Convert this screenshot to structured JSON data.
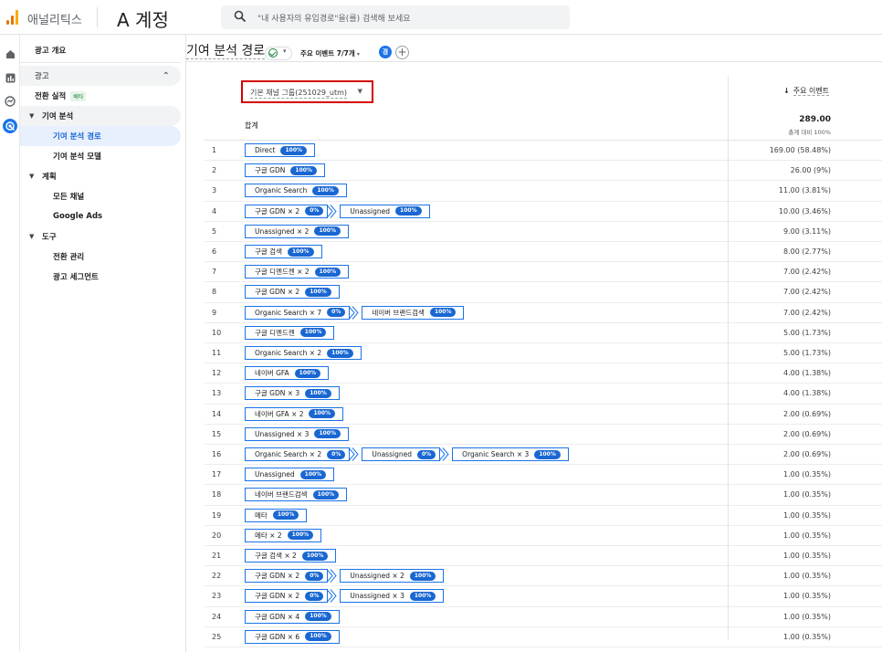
{
  "app": {
    "product_name": "애널리틱스",
    "account_name": "A 계정"
  },
  "search": {
    "placeholder": "\"내 사용자의 유입경로\"을(를) 검색해 보세요"
  },
  "rail": {
    "icons": [
      "home-icon",
      "reports-icon",
      "explore-icon",
      "advertising-icon"
    ]
  },
  "sidebar": {
    "overview": "광고 개요",
    "ads_group": "광고",
    "conversion_perf": "전환 실적",
    "beta": "베타",
    "attribution": "기여 분석",
    "attribution_paths": "기여 분석 경로",
    "attribution_models": "기여 분석 모델",
    "planning": "계획",
    "all_channels": "모든 채널",
    "google_ads": "Google Ads",
    "tools": "도구",
    "conversion_mgmt": "전환 관리",
    "ad_segments": "광고 세그먼트"
  },
  "header": {
    "page_title": "기여 분석 경로",
    "key_events_filter": "주요 이벤트 7/7개",
    "avatar_letter": "경"
  },
  "table": {
    "dimension_label": "기본 채널 그룹(251029_utm)",
    "metric_label": "주요 이벤트",
    "total_label": "합계",
    "total_value": "289.00",
    "total_sub": "총계 대비 100%",
    "rows": [
      {
        "n": "1",
        "steps": [
          {
            "label": "Direct",
            "pct": "100%"
          }
        ],
        "value": "169.00 (58.48%)"
      },
      {
        "n": "2",
        "steps": [
          {
            "label": "구글 GDN",
            "pct": "100%"
          }
        ],
        "value": "26.00 (9%)"
      },
      {
        "n": "3",
        "steps": [
          {
            "label": "Organic Search",
            "pct": "100%"
          }
        ],
        "value": "11.00 (3.81%)"
      },
      {
        "n": "4",
        "steps": [
          {
            "label": "구글 GDN × 2",
            "pct": "0%"
          },
          {
            "label": "Unassigned",
            "pct": "100%"
          }
        ],
        "value": "10.00 (3.46%)"
      },
      {
        "n": "5",
        "steps": [
          {
            "label": "Unassigned × 2",
            "pct": "100%"
          }
        ],
        "value": "9.00 (3.11%)"
      },
      {
        "n": "6",
        "steps": [
          {
            "label": "구글 검색",
            "pct": "100%"
          }
        ],
        "value": "8.00 (2.77%)"
      },
      {
        "n": "7",
        "steps": [
          {
            "label": "구글 디멘드젠 × 2",
            "pct": "100%"
          }
        ],
        "value": "7.00 (2.42%)"
      },
      {
        "n": "8",
        "steps": [
          {
            "label": "구글 GDN × 2",
            "pct": "100%"
          }
        ],
        "value": "7.00 (2.42%)"
      },
      {
        "n": "9",
        "steps": [
          {
            "label": "Organic Search × 7",
            "pct": "0%"
          },
          {
            "label": "네이버 브랜드검색",
            "pct": "100%"
          }
        ],
        "value": "7.00 (2.42%)"
      },
      {
        "n": "10",
        "steps": [
          {
            "label": "구글 디멘드젠",
            "pct": "100%"
          }
        ],
        "value": "5.00 (1.73%)"
      },
      {
        "n": "11",
        "steps": [
          {
            "label": "Organic Search × 2",
            "pct": "100%"
          }
        ],
        "value": "5.00 (1.73%)"
      },
      {
        "n": "12",
        "steps": [
          {
            "label": "네이버 GFA",
            "pct": "100%"
          }
        ],
        "value": "4.00 (1.38%)"
      },
      {
        "n": "13",
        "steps": [
          {
            "label": "구글 GDN × 3",
            "pct": "100%"
          }
        ],
        "value": "4.00 (1.38%)"
      },
      {
        "n": "14",
        "steps": [
          {
            "label": "네이버 GFA × 2",
            "pct": "100%"
          }
        ],
        "value": "2.00 (0.69%)"
      },
      {
        "n": "15",
        "steps": [
          {
            "label": "Unassigned × 3",
            "pct": "100%"
          }
        ],
        "value": "2.00 (0.69%)"
      },
      {
        "n": "16",
        "steps": [
          {
            "label": "Organic Search × 2",
            "pct": "0%"
          },
          {
            "label": "Unassigned",
            "pct": "0%"
          },
          {
            "label": "Organic Search × 3",
            "pct": "100%"
          }
        ],
        "value": "2.00 (0.69%)"
      },
      {
        "n": "17",
        "steps": [
          {
            "label": "Unassigned",
            "pct": "100%"
          }
        ],
        "value": "1.00 (0.35%)"
      },
      {
        "n": "18",
        "steps": [
          {
            "label": "네이버 브랜드검색",
            "pct": "100%"
          }
        ],
        "value": "1.00 (0.35%)"
      },
      {
        "n": "19",
        "steps": [
          {
            "label": "메타",
            "pct": "100%"
          }
        ],
        "value": "1.00 (0.35%)"
      },
      {
        "n": "20",
        "steps": [
          {
            "label": "메타 × 2",
            "pct": "100%"
          }
        ],
        "value": "1.00 (0.35%)"
      },
      {
        "n": "21",
        "steps": [
          {
            "label": "구글 검색 × 2",
            "pct": "100%"
          }
        ],
        "value": "1.00 (0.35%)"
      },
      {
        "n": "22",
        "steps": [
          {
            "label": "구글 GDN × 2",
            "pct": "0%"
          },
          {
            "label": "Unassigned × 2",
            "pct": "100%"
          }
        ],
        "value": "1.00 (0.35%)"
      },
      {
        "n": "23",
        "steps": [
          {
            "label": "구글 GDN × 2",
            "pct": "0%"
          },
          {
            "label": "Unassigned × 3",
            "pct": "100%"
          }
        ],
        "value": "1.00 (0.35%)"
      },
      {
        "n": "24",
        "steps": [
          {
            "label": "구글 GDN × 4",
            "pct": "100%"
          }
        ],
        "value": "1.00 (0.35%)"
      },
      {
        "n": "25",
        "steps": [
          {
            "label": "구글 GDN × 6",
            "pct": "100%"
          }
        ],
        "value": "1.00 (0.35%)"
      }
    ]
  },
  "colors": {
    "accent": "#1a73e8",
    "chip_fill": "#1967d2",
    "highlight_box": "#d50000",
    "selected_bg": "#e8f0fe"
  }
}
